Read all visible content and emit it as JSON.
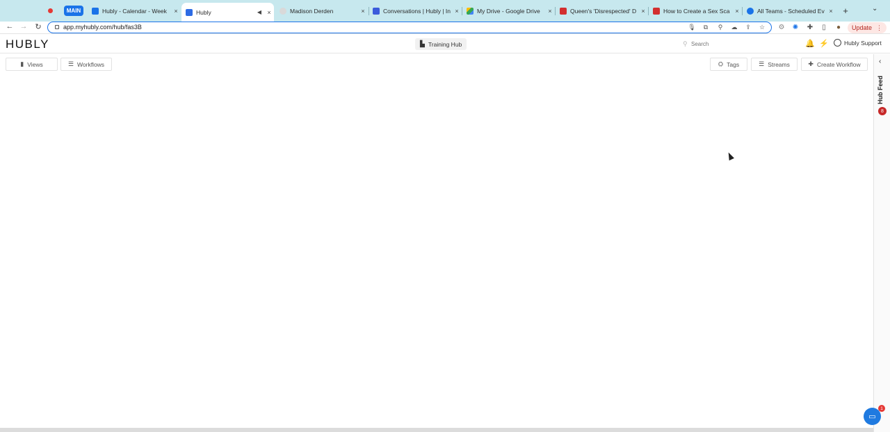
{
  "browser": {
    "tab_group_label": "MAIN",
    "tabs": [
      {
        "title": "Hubly - Calendar - Week",
        "favicon_color": "#1a73e8",
        "active": false
      },
      {
        "title": "Hubly",
        "favicon_color": "#2d6be4",
        "active": true
      },
      {
        "title": "Madison Derden",
        "favicon_color": "#d9d9d9",
        "active": false
      },
      {
        "title": "Conversations | Hubly | In",
        "favicon_color": "#3b5bdb",
        "active": false
      },
      {
        "title": "My Drive - Google Drive",
        "favicon_color": "#34a853",
        "active": false
      },
      {
        "title": "Queen's 'Disrespected' D",
        "favicon_color": "#d32f2f",
        "active": false
      },
      {
        "title": "How to Create a Sex Sca",
        "favicon_color": "#d32f2f",
        "active": false
      },
      {
        "title": "All Teams - Scheduled Ev",
        "favicon_color": "#1a73e8",
        "active": false
      }
    ],
    "close_glyph": "×",
    "new_tab_glyph": "+",
    "url": "app.myhubly.com/hub/fas3B",
    "update_label": "Update"
  },
  "app": {
    "logo": "HUBLY",
    "hub_selector_label": "Training Hub",
    "search_placeholder": "Search",
    "user_name": "Hubly Support"
  },
  "subheader": {
    "views_label": "Views",
    "workflows_label": "Workflows",
    "tags_label": "Tags",
    "streams_label": "Streams",
    "create_workflow_label": "Create Workflow"
  },
  "hub_feed": {
    "label": "Hub Feed",
    "badge_count": "8"
  },
  "chat": {
    "badge_count": "1"
  },
  "colors": {
    "tabstrip_bg": "#c7e8ee",
    "accent": "#1a73e8",
    "badge_red": "#c62828"
  }
}
